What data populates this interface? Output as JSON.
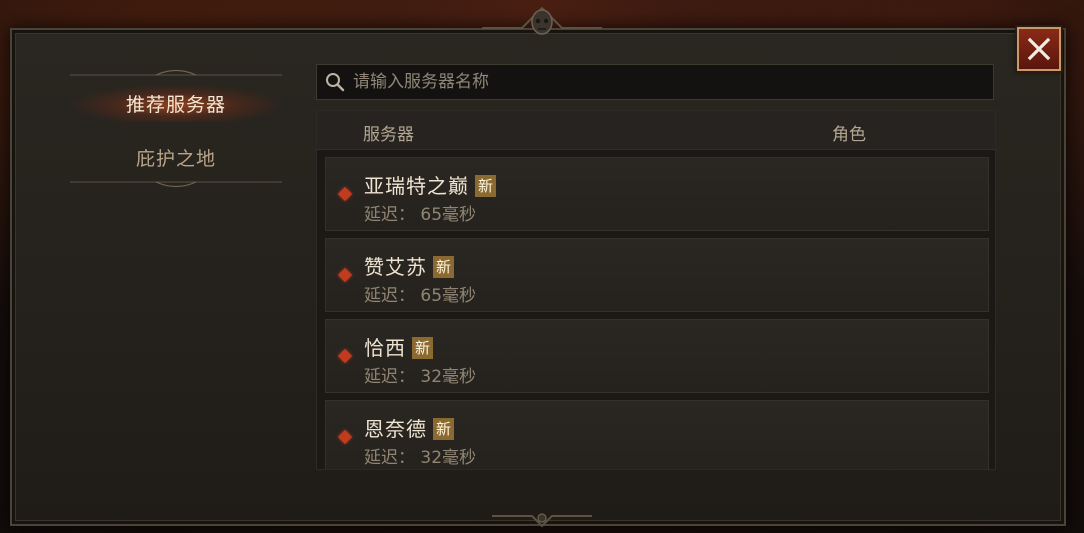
{
  "side_nav": {
    "items": [
      {
        "label": "推荐服务器",
        "active": true
      },
      {
        "label": "庇护之地",
        "active": false
      }
    ]
  },
  "search": {
    "placeholder": "请输入服务器名称",
    "value": ""
  },
  "list": {
    "headers": {
      "server": "服务器",
      "role": "角色"
    },
    "rows": [
      {
        "name": "亚瑞特之巅",
        "badge": "新",
        "latency": "延迟： 65毫秒"
      },
      {
        "name": "赞艾苏",
        "badge": "新",
        "latency": "延迟： 65毫秒"
      },
      {
        "name": "恰西",
        "badge": "新",
        "latency": "延迟： 32毫秒"
      },
      {
        "name": "恩奈德",
        "badge": "新",
        "latency": "延迟： 32毫秒"
      }
    ]
  },
  "icons": {
    "close": "close-icon",
    "search": "search-icon",
    "row_marker": "diamond-icon",
    "ornament": "skull-ornament-icon"
  },
  "colors": {
    "accent_red": "#c23b1e",
    "badge_gold": "#8a6a30",
    "active_glow": "#e65a1e",
    "text_light": "#efe4d1",
    "text_muted": "#908573"
  }
}
